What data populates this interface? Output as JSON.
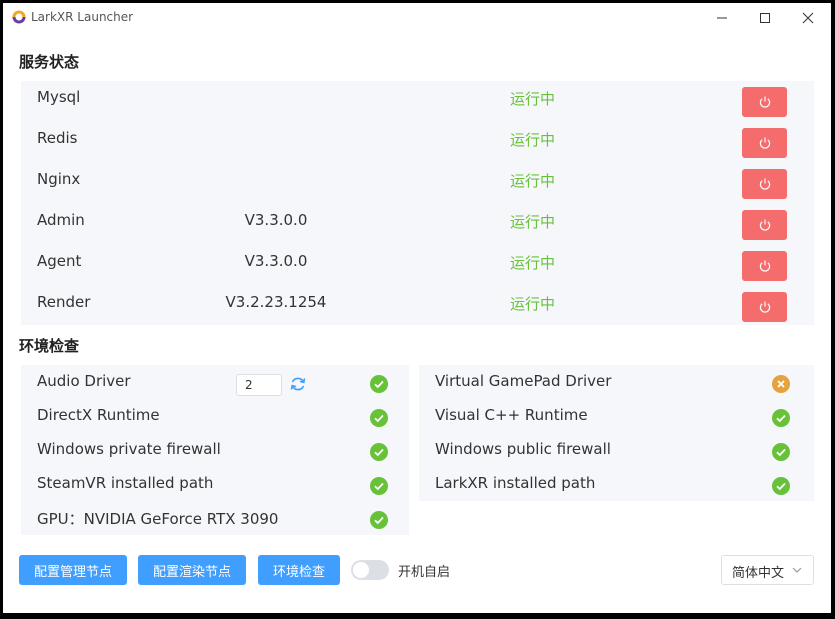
{
  "window": {
    "title": "LarkXR Launcher"
  },
  "services": {
    "title": "服务状态",
    "rows": [
      {
        "name": "Mysql",
        "version": "",
        "status": "运行中"
      },
      {
        "name": "Redis",
        "version": "",
        "status": "运行中"
      },
      {
        "name": "Nginx",
        "version": "",
        "status": "运行中"
      },
      {
        "name": "Admin",
        "version": "V3.3.0.0",
        "status": "运行中"
      },
      {
        "name": "Agent",
        "version": "V3.3.0.0",
        "status": "运行中"
      },
      {
        "name": "Render",
        "version": "V3.2.23.1254",
        "status": "运行中"
      }
    ]
  },
  "env": {
    "title": "环境检查",
    "left": [
      {
        "label": "Audio Driver",
        "state": "ok",
        "input_value": "2"
      },
      {
        "label": "DirectX Runtime",
        "state": "ok"
      },
      {
        "label": "Windows private firewall",
        "state": "ok"
      },
      {
        "label": "SteamVR installed path",
        "state": "ok"
      },
      {
        "label": "GPU：NVIDIA GeForce RTX 3090",
        "state": "ok"
      }
    ],
    "right": [
      {
        "label": "Virtual GamePad Driver",
        "state": "error"
      },
      {
        "label": "Visual C++ Runtime",
        "state": "ok"
      },
      {
        "label": "Windows public firewall",
        "state": "ok"
      },
      {
        "label": "LarkXR installed path",
        "state": "ok"
      }
    ]
  },
  "footer": {
    "btn_config_admin": "配置管理节点",
    "btn_config_render": "配置渲染节点",
    "btn_env_check": "环境检查",
    "autostart_label": "开机自启",
    "autostart_on": false,
    "language": "简体中文"
  },
  "colors": {
    "ok": "#67c23a",
    "warn": "#e6a23c",
    "danger": "#f56c6c",
    "primary": "#409eff"
  }
}
